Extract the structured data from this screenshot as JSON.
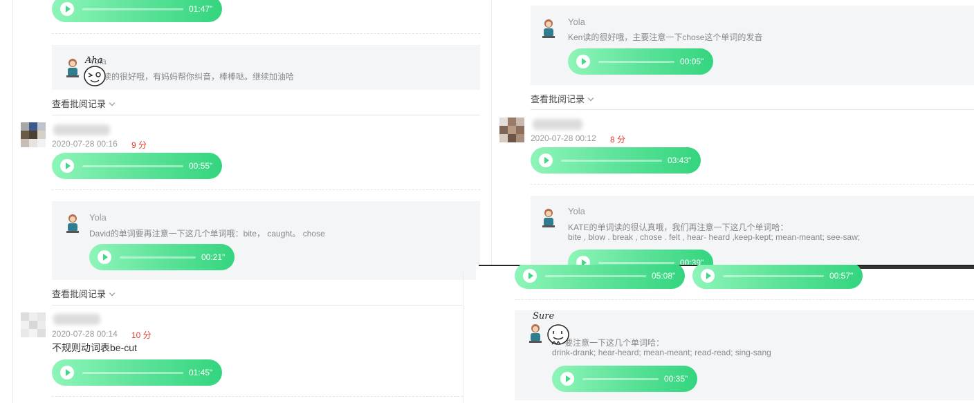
{
  "left": {
    "top_player": {
      "duration": "01:47\""
    },
    "review_1": {
      "teacher": "Yola",
      "comment": "读的很好哦，有妈妈帮你纠音，棒棒哒。继续加油哈"
    },
    "toggle_1": "查看批阅记录",
    "sub_2": {
      "date": "2020-07-28 00:16",
      "score": "9 分",
      "duration": "00:55\""
    },
    "review_2": {
      "teacher": "Yola",
      "comment": "David的单词要再注意一下这几个单词哦：bite， caught。 chose",
      "duration": "00:21\""
    },
    "toggle_2": "查看批阅记录",
    "sub_3": {
      "date": "2020-07-28 00:14",
      "score": "10 分",
      "title": "不规则动词表be-cut",
      "duration": "01:45\""
    }
  },
  "right": {
    "review_1": {
      "teacher": "Yola",
      "comment": "Ken读的很好哦，主要注意一下chose这个单词的发音",
      "duration": "00:05\""
    },
    "toggle_1": "查看批阅记录",
    "sub_2": {
      "date": "2020-07-28 00:12",
      "score": "8 分",
      "duration": "03:43\""
    },
    "review_2": {
      "teacher": "Yola",
      "comment_line1": "KATE的单词读的很认真哦，我们再注意一下这几个单词哈：",
      "comment_line2": "bite , blow . break , chose . felt , hear- heard ,keep-kept; mean-meant; see-saw;",
      "duration": "00:39\""
    }
  },
  "bottom_right": {
    "player_a": {
      "duration": "05:08\""
    },
    "player_b": {
      "duration": "00:57\""
    },
    "review": {
      "comment_line1": "要注意一下这几个单词哈：",
      "comment_line2": "drink-drank; hear-heard; mean-meant; read-read; sing-sang",
      "duration": "00:35\""
    }
  },
  "stickers": {
    "left_text": "Aha",
    "right_text": "Sure"
  },
  "colors": {
    "accent_green": "#3ddc84",
    "score_red": "#e23b2a",
    "review_bg": "#f4f5f7"
  }
}
